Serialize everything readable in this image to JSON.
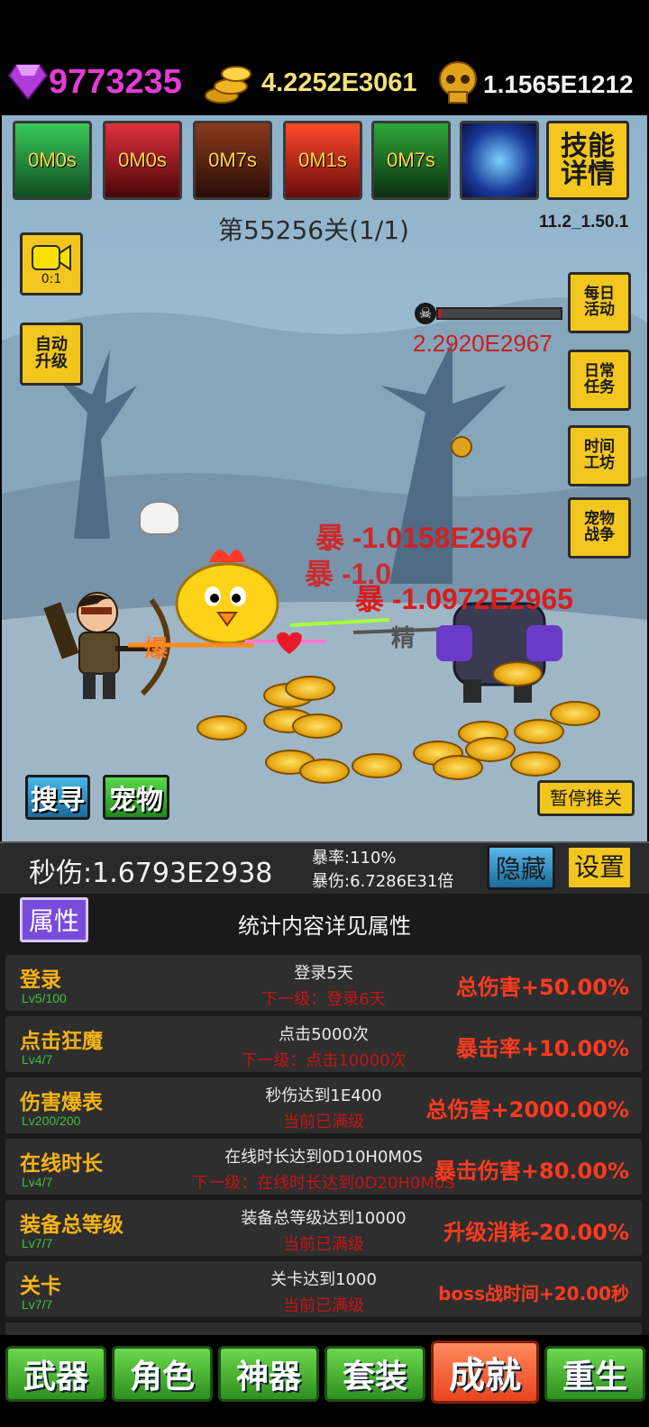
{
  "currencies": {
    "gems": "9773235",
    "gold": "4.2252E3061",
    "skulls": "1.1565E1212"
  },
  "skills": [
    {
      "timer": "0M0s",
      "color": "#1f8a3a"
    },
    {
      "timer": "0M0s",
      "color": "#b0171a"
    },
    {
      "timer": "0M7s",
      "color": "#6a1f15"
    },
    {
      "timer": "0M1s",
      "color": "#c42018"
    },
    {
      "timer": "0M7s",
      "color": "#176b1e"
    },
    {
      "timer": "",
      "color": "#1c3f9a"
    }
  ],
  "skill_details_button": "技能\n详情",
  "stage": {
    "label": "第55256关(1/1)",
    "version": "11.2_1.50.1"
  },
  "video_button": {
    "speed": "0:1"
  },
  "auto_upgrade_button": "自动\n升级",
  "side_buttons": {
    "daily": "每日\n活动",
    "tasks": "日常\n任务",
    "workshop": "时间\n工坊",
    "pet_war": "宠物\n战争"
  },
  "boss": {
    "hp": "2.2920E2967",
    "hp_fraction": 0.02
  },
  "damage_texts": {
    "crit1": "暴 -1.0158E2967",
    "crit2": "暴 -1.0",
    "crit3": "暴 -1.0972E2965",
    "crit_hero": "爆",
    "elite": "精"
  },
  "scene_buttons": {
    "search": "搜寻",
    "pet": "宠物",
    "pause": "暂停推关"
  },
  "stats": {
    "dps": "秒伤:1.6793E2938",
    "crit_rate": "暴率:110%",
    "crit_damage": "暴伤:6.7286E31倍",
    "hide": "隐藏",
    "settings": "设置"
  },
  "panel": {
    "attr_button": "属性",
    "title": "统计内容详见属性",
    "achievements": [
      {
        "name": "登录",
        "level": "Lv5/100",
        "condition": "登录5天",
        "next": "下一级：登录6天",
        "bonus": "总伤害+50.00%"
      },
      {
        "name": "点击狂魔",
        "level": "Lv4/7",
        "condition": "点击5000次",
        "next": "下一级：点击10000次",
        "bonus": "暴击率+10.00%"
      },
      {
        "name": "伤害爆表",
        "level": "Lv200/200",
        "condition": "秒伤达到1E400",
        "next": "当前已满级",
        "bonus": "总伤害+2000.00%"
      },
      {
        "name": "在线时长",
        "level": "Lv4/7",
        "condition": "在线时长达到0D10H0M0S",
        "next": "下一级：在线时长达到0D20H0M0S",
        "bonus": "暴击伤害+80.00%"
      },
      {
        "name": "装备总等级",
        "level": "Lv7/7",
        "condition": "装备总等级达到10000",
        "next": "当前已满级",
        "bonus": "升级消耗-20.00%"
      },
      {
        "name": "关卡",
        "level": "Lv7/7",
        "condition": "关卡达到1000",
        "next": "当前已满级",
        "bonus": "boss战时间+20.00秒"
      }
    ]
  },
  "nav": {
    "tabs": [
      {
        "label": "武器",
        "active": false
      },
      {
        "label": "角色",
        "active": false
      },
      {
        "label": "神器",
        "active": false
      },
      {
        "label": "套装",
        "active": false
      },
      {
        "label": "成就",
        "active": true
      },
      {
        "label": "重生",
        "active": false
      }
    ]
  }
}
